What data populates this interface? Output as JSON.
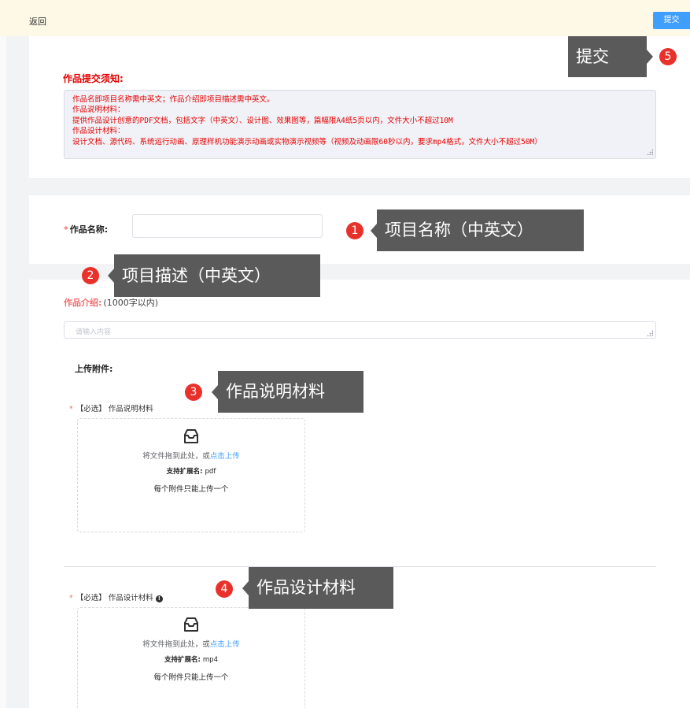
{
  "header": {
    "back_label": "返回",
    "submit_label": "提交"
  },
  "notice": {
    "title": "作品提交须知:",
    "lines": [
      "作品名即项目名称需中英文；作品介绍即项目描述需中英文。",
      "作品说明材料：",
      "提供作品设计创意的PDF文档，包括文字（中英文）、设计图、效果图等，篇幅限A4纸5页以内，文件大小不超过10M",
      "作品设计材料：",
      "设计文档、源代码、系统运行动画、原理样机功能演示动画或实物演示视频等（视频及动画限60秒以内，要求mp4格式，文件大小不超过50M）"
    ]
  },
  "form": {
    "name_label": "作品名称:",
    "intro_label": "作品介绍:",
    "intro_hint": "(1000字以内)",
    "intro_placeholder": "请输入内容",
    "attachments_label": "上传附件:",
    "explain_upload": {
      "label": "【必选】 作品说明材料",
      "drop_text": "将文件拖到此处，或",
      "drop_link": "点击上传",
      "ext_label": "支持扩展名:",
      "ext_value": "pdf",
      "one_text": "每个附件只能上传一个"
    },
    "design_upload": {
      "label": "【必选】 作品设计材料",
      "info_icon": "!",
      "drop_text": "将文件拖到此处，或",
      "drop_link": "点击上传",
      "ext_label": "支持扩展名:",
      "ext_value": "mp4",
      "one_text": "每个附件只能上传一个"
    }
  },
  "annotations": [
    {
      "num": "1",
      "text": "项目名称（中英文）"
    },
    {
      "num": "2",
      "text": "项目描述（中英文）"
    },
    {
      "num": "3",
      "text": "作品说明材料"
    },
    {
      "num": "4",
      "text": "作品设计材料"
    },
    {
      "num": "5",
      "text": "提交"
    }
  ],
  "colors": {
    "notice_red": "#e60000",
    "primary_blue": "#409eff",
    "badge_red": "#e8312a",
    "callout_gray": "#5a5a5a"
  }
}
